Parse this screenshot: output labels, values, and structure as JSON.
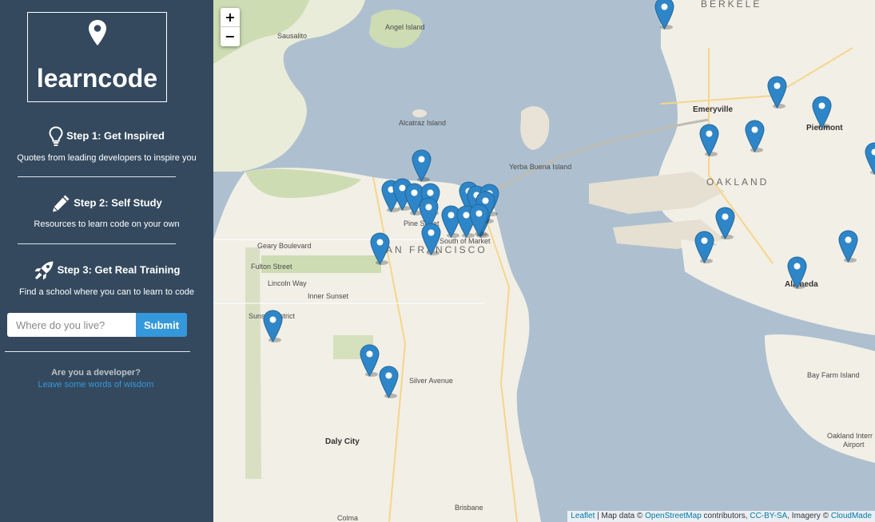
{
  "brand": {
    "name": "learncode",
    "icon": "map-pin-icon"
  },
  "steps": [
    {
      "title": "Step 1: Get Inspired",
      "desc": "Quotes from leading developers to inspire you",
      "icon": "lightbulb-icon"
    },
    {
      "title": "Step 2: Self Study",
      "desc": "Resources to learn code on your own",
      "icon": "pencil-icon"
    },
    {
      "title": "Step 3: Get Real Training",
      "desc": "Find a school where you can to learn to code",
      "icon": "rocket-icon"
    }
  ],
  "search": {
    "placeholder": "Where do you live?",
    "submit_label": "Submit"
  },
  "developer": {
    "question": "Are you a developer?",
    "link": "Leave some words of wisdom"
  },
  "map": {
    "zoom_in": "+",
    "zoom_out": "−",
    "labels": {
      "sausalito": "Sausalito",
      "angel_island": "Angel Island",
      "alcatraz": "Alcatraz Island",
      "yerba_buena": "Yerba Buena Island",
      "emeryville": "Emeryville",
      "piedmont": "Piedmont",
      "oakland": "OAKLAND",
      "berkeley": "BERKELE",
      "san_francisco": "SAN FRANCISCO",
      "south_of_market": "South of Market",
      "pine_street": "Pine Street",
      "geary": "Geary Boulevard",
      "fulton": "Fulton Street",
      "lincoln_way": "Lincoln Way",
      "inner_sunset": "Inner Sunset",
      "sunset_district": "Sunset District",
      "daly_city": "Daly City",
      "brisbane": "Brisbane",
      "alameda": "Alameda",
      "bay_farm": "Bay Farm Island",
      "oakland_intl": "Oakland Interr",
      "oakland_airport": "Airport",
      "colma": "Colma",
      "silver_ave": "Silver Avenue"
    },
    "attribution": {
      "leaflet": "Leaflet",
      "map_data": " | Map data © ",
      "osm": "OpenStreetMap",
      "contributors": " contributors, ",
      "license": "CC-BY-SA",
      "imagery": ", Imagery © ",
      "provider": "CloudMade"
    },
    "marker_color": "#2e86c8"
  },
  "colors": {
    "sidebar": "#34495e",
    "accent": "#3498db",
    "water": "#aec0cf",
    "land": "#f2efe6"
  }
}
